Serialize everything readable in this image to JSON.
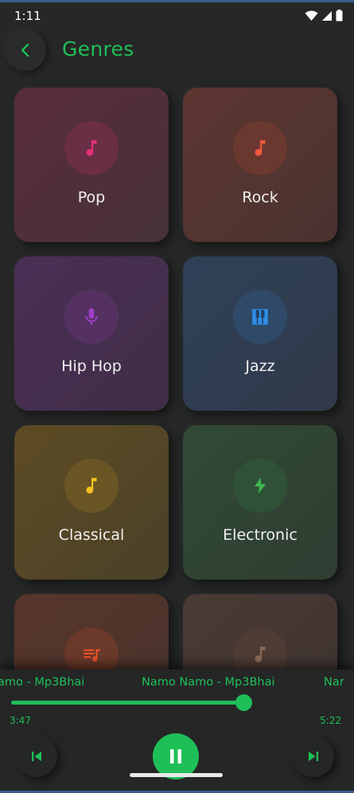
{
  "status": {
    "time": "1:11"
  },
  "appbar": {
    "title": "Genres"
  },
  "genres": [
    {
      "label": "Pop",
      "icon": "music-note-icon",
      "color": "#e4307a"
    },
    {
      "label": "Rock",
      "icon": "music-note-icon",
      "color": "#ef5a3c"
    },
    {
      "label": "Hip Hop",
      "icon": "microphone-icon",
      "color": "#a040c8"
    },
    {
      "label": "Jazz",
      "icon": "piano-icon",
      "color": "#2f8fe8"
    },
    {
      "label": "Classical",
      "icon": "music-note-icon",
      "color": "#f5c220"
    },
    {
      "label": "Electronic",
      "icon": "lightning-icon",
      "color": "#3db84f"
    },
    {
      "label": "",
      "icon": "playlist-icon",
      "color": "#f0542c"
    },
    {
      "label": "",
      "icon": "music-note-icon",
      "color": "#8f6a55"
    }
  ],
  "player": {
    "marquee": [
      "amo - Mp3Bhai",
      "Namo Namo - Mp3Bhai",
      "Nar"
    ],
    "current_time": "3:47",
    "total_time": "5:22",
    "progress": 0.73,
    "accent": "#1fbf57",
    "state": "playing"
  }
}
